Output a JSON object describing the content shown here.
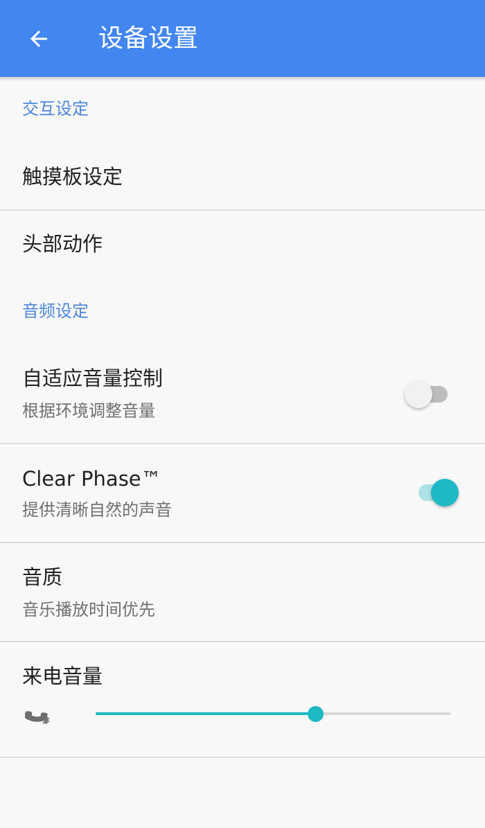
{
  "appbar": {
    "title": "设备设置",
    "back_icon": "arrow-back-icon",
    "color": "#4286f0"
  },
  "sections": {
    "interaction": "交互设定",
    "audio": "音频设定"
  },
  "items": {
    "touchpad": {
      "title": "触摸板设定"
    },
    "head_gesture": {
      "title": "头部动作"
    },
    "adaptive_volume": {
      "title": "自适应音量控制",
      "subtitle": "根据环境调整音量",
      "enabled": false
    },
    "clear_phase": {
      "title": "Clear Phase™",
      "subtitle": "提供清晰自然的声音",
      "enabled": true
    },
    "sound_quality": {
      "title": "音质",
      "subtitle": "音乐播放时间优先"
    },
    "ring_volume": {
      "title": "来电音量",
      "icon": "bluetooth-call-icon",
      "level": 0.62
    }
  },
  "colors": {
    "accent": "#1fb8c5",
    "section": "#4a86de"
  }
}
